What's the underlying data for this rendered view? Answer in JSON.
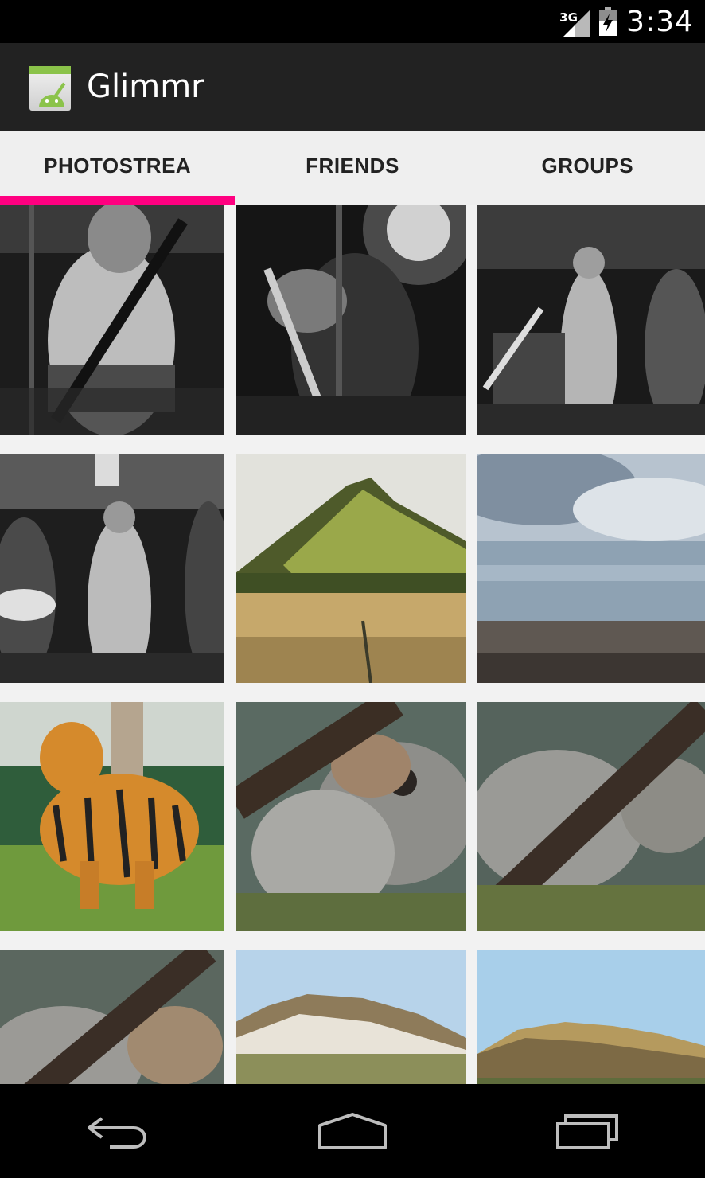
{
  "status_bar": {
    "network": "3G",
    "time": "3:34",
    "icons": [
      "signal-icon",
      "battery-icon"
    ]
  },
  "action_bar": {
    "app_icon": "android-icon",
    "title": "Glimmr"
  },
  "tabs": [
    {
      "label": "PHOTOSTREA",
      "selected": true
    },
    {
      "label": "FRIENDS",
      "selected": false
    },
    {
      "label": "GROUPS",
      "selected": false
    }
  ],
  "colors": {
    "status_bar": "#000000",
    "action_bar": "#222222",
    "tab_background": "#efefef",
    "tab_indicator": "#ff0080",
    "grid_background": "#f2f2f2"
  },
  "photos": [
    {
      "subject": "guitarist on stage, black and white"
    },
    {
      "subject": "bassist under stage light, black and white"
    },
    {
      "subject": "band performing, black and white"
    },
    {
      "subject": "band with guitars, black and white"
    },
    {
      "subject": "green hill with field"
    },
    {
      "subject": "stormy sea and rocky shore"
    },
    {
      "subject": "tiger standing in enclosure"
    },
    {
      "subject": "grey squirrel eating on branch"
    },
    {
      "subject": "grey squirrel behind branch"
    },
    {
      "subject": "grey squirrel partial"
    },
    {
      "subject": "snowy mountain ridge, blue sky"
    },
    {
      "subject": "rocky mountain ridge, blue sky"
    }
  ],
  "nav_bar": {
    "buttons": [
      "back-icon",
      "home-icon",
      "recent-apps-icon"
    ]
  }
}
